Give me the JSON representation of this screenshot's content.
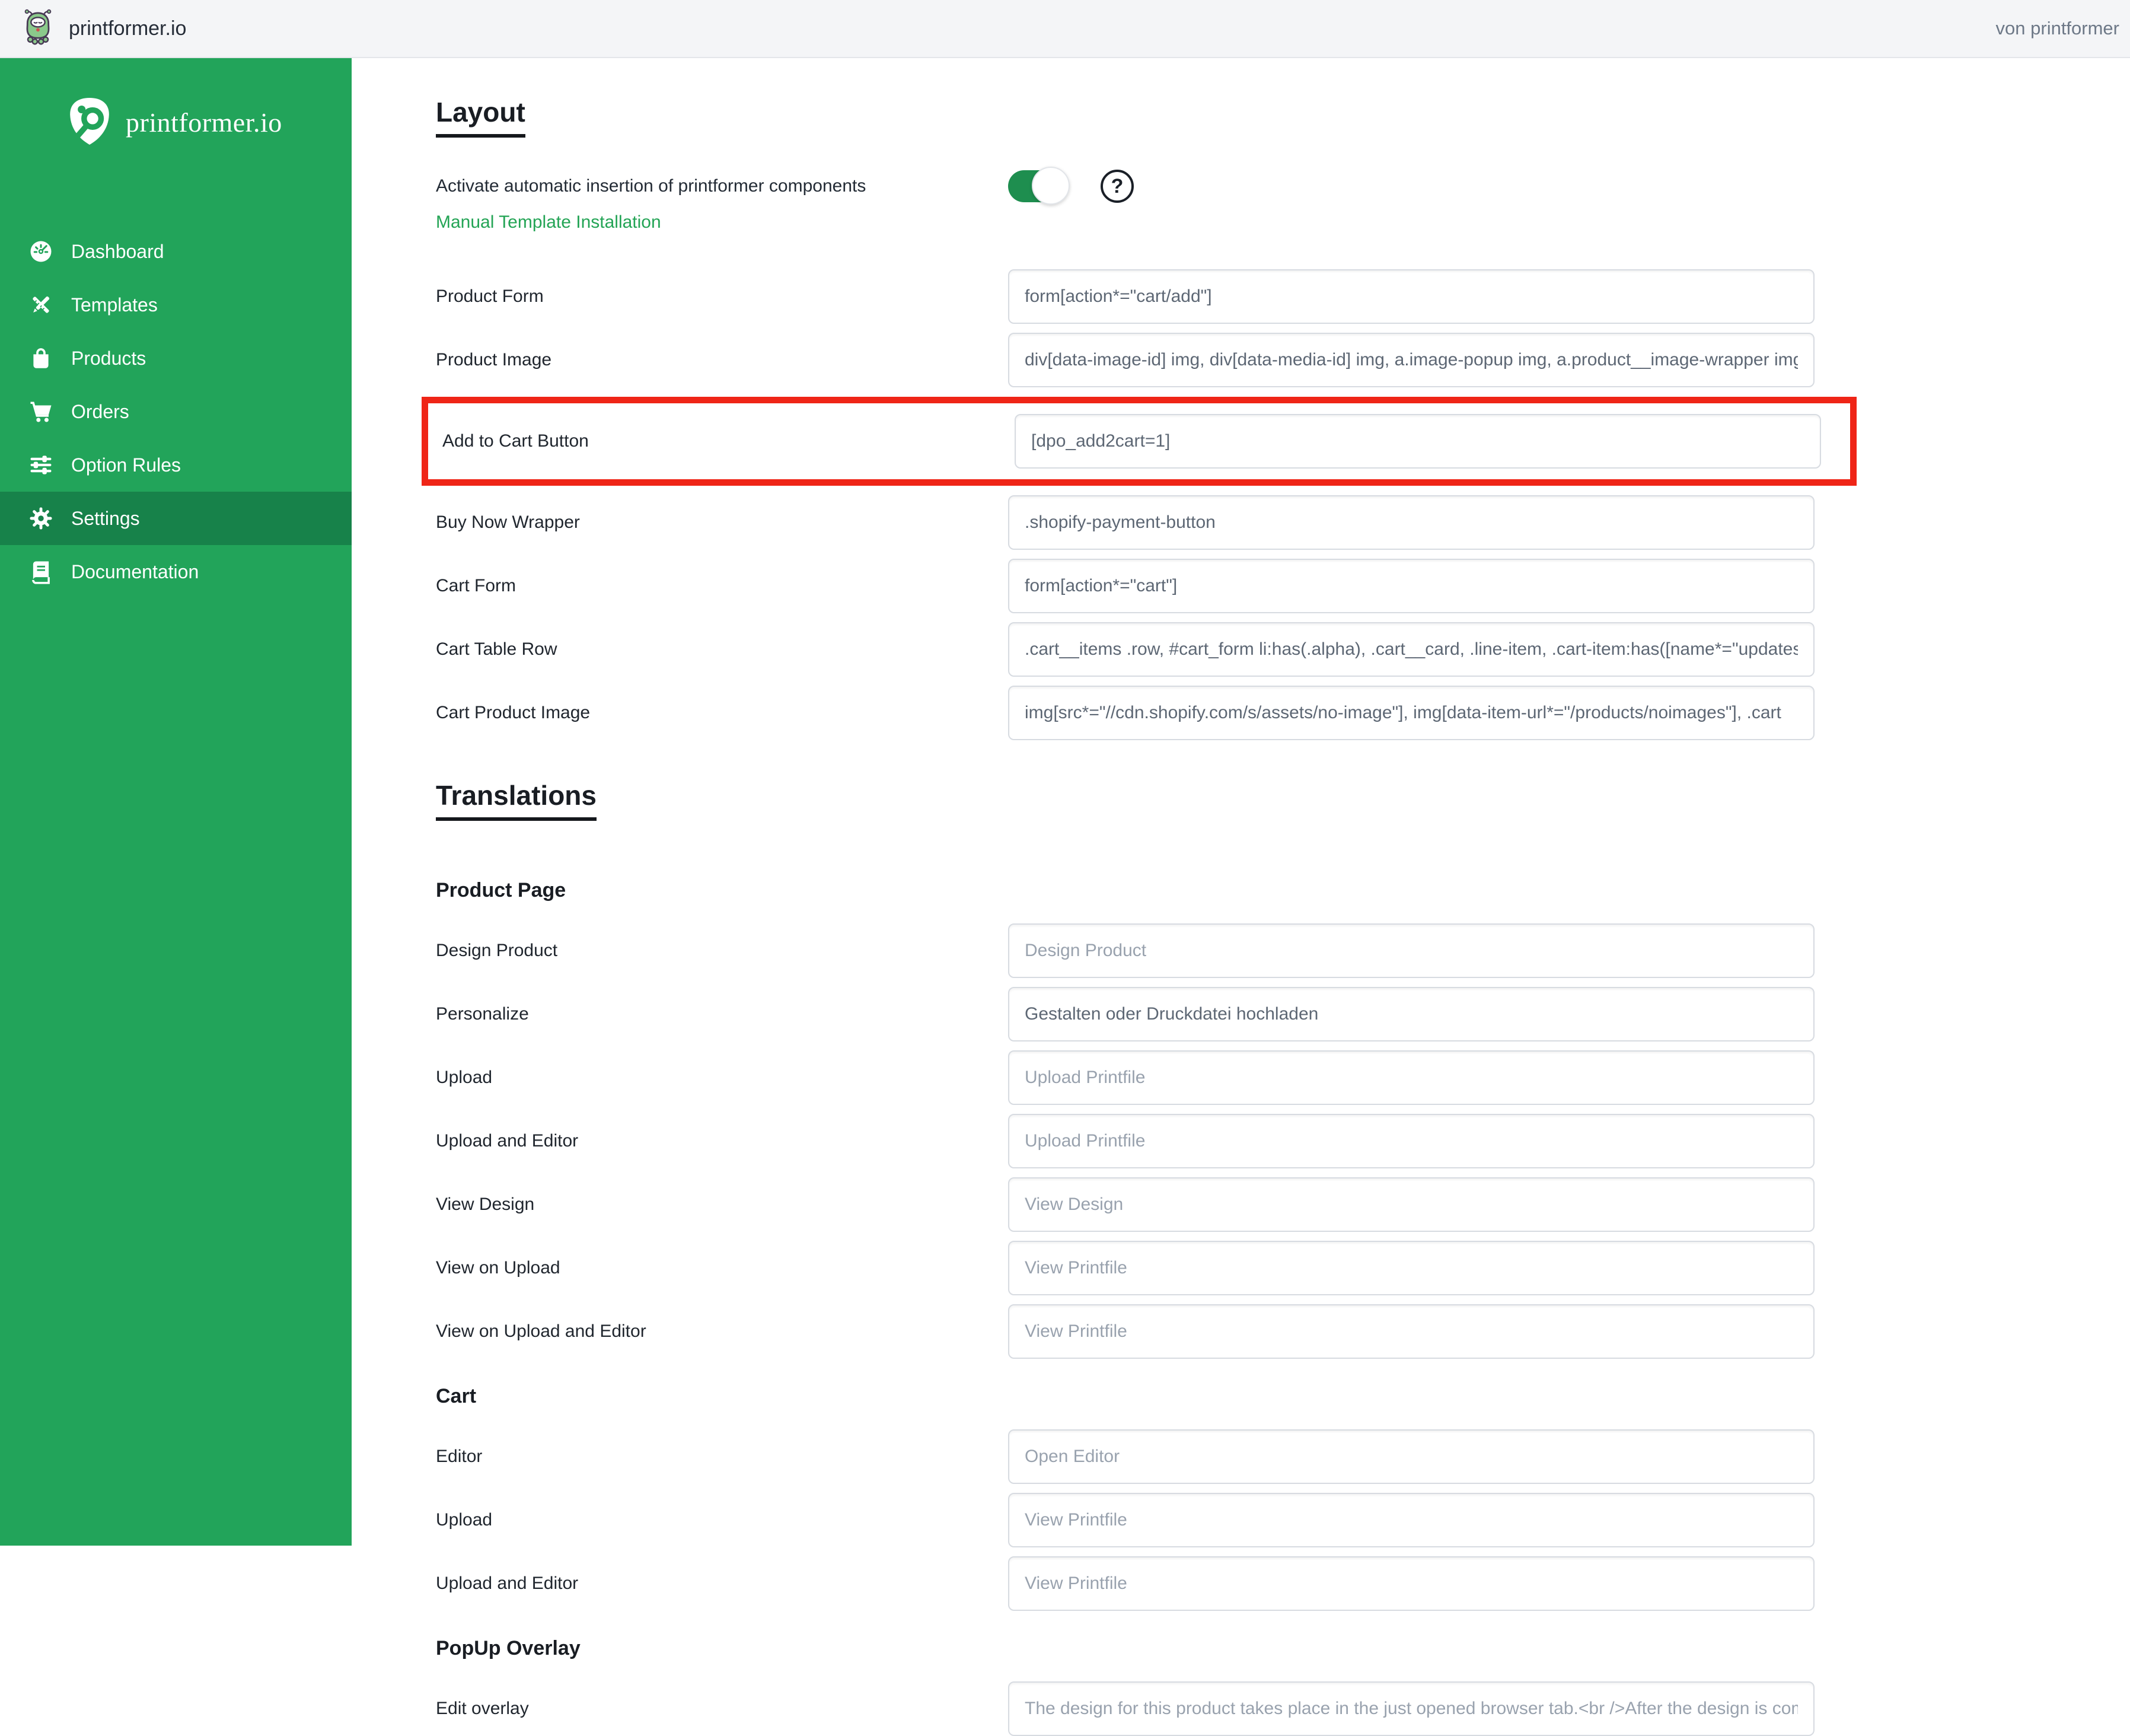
{
  "header": {
    "app_title": "printformer.io",
    "byline": "von printformer"
  },
  "sidebar": {
    "brand": "printformer.io",
    "items": [
      {
        "label": "Dashboard",
        "icon": "gauge-icon",
        "active": false
      },
      {
        "label": "Templates",
        "icon": "pencil-ruler-icon",
        "active": false
      },
      {
        "label": "Products",
        "icon": "shopping-bag-icon",
        "active": false
      },
      {
        "label": "Orders",
        "icon": "cart-icon",
        "active": false
      },
      {
        "label": "Option Rules",
        "icon": "sliders-icon",
        "active": false
      },
      {
        "label": "Settings",
        "icon": "gear-icon",
        "active": true
      },
      {
        "label": "Documentation",
        "icon": "book-icon",
        "active": false
      }
    ]
  },
  "main": {
    "layout_section": {
      "title": "Layout",
      "toggle_label": "Activate automatic insertion of printformer components",
      "toggle_state": "on",
      "help_glyph": "?",
      "manual_link": "Manual Template Installation",
      "rows": [
        {
          "label": "Product Form",
          "value": "form[action*=\"cart/add\"]"
        },
        {
          "label": "Product Image",
          "value": "div[data-image-id] img, div[data-media-id] img, a.image-popup img, a.product__image-wrapper img"
        },
        {
          "label": "Add to Cart Button",
          "value": "[dpo_add2cart=1]",
          "highlighted": true
        },
        {
          "label": "Buy Now Wrapper",
          "value": ".shopify-payment-button"
        },
        {
          "label": "Cart Form",
          "value": "form[action*=\"cart\"]"
        },
        {
          "label": "Cart Table Row",
          "value": ".cart__items .row, #cart_form li:has(.alpha), .cart__card, .line-item, .cart-item:has([name*=\"updates\"]"
        },
        {
          "label": "Cart Product Image",
          "value": "img[src*=\"//cdn.shopify.com/s/assets/no-image\"], img[data-item-url*=\"/products/noimages\"], .cart"
        }
      ]
    },
    "translations_section": {
      "title": "Translations",
      "groups": [
        {
          "heading": "Product Page",
          "rows": [
            {
              "label": "Design Product",
              "placeholder": "Design Product"
            },
            {
              "label": "Personalize",
              "value": "Gestalten oder Druckdatei hochladen"
            },
            {
              "label": "Upload",
              "placeholder": "Upload Printfile"
            },
            {
              "label": "Upload and Editor",
              "placeholder": "Upload Printfile"
            },
            {
              "label": "View Design",
              "placeholder": "View Design"
            },
            {
              "label": "View on Upload",
              "placeholder": "View Printfile"
            },
            {
              "label": "View on Upload and Editor",
              "placeholder": "View Printfile"
            }
          ]
        },
        {
          "heading": "Cart",
          "rows": [
            {
              "label": "Editor",
              "placeholder": "Open Editor"
            },
            {
              "label": "Upload",
              "placeholder": "View Printfile"
            },
            {
              "label": "Upload and Editor",
              "placeholder": "View Printfile"
            }
          ]
        },
        {
          "heading": "PopUp Overlay",
          "rows": [
            {
              "label": "Edit overlay",
              "placeholder": "The design for this product takes place in the just opened browser tab.<br />After the design is com"
            }
          ]
        }
      ]
    }
  },
  "colors": {
    "sidebar_green": "#22a45a",
    "active_item_green": "#17824a",
    "toggle_green": "#1e8e4f",
    "link_green": "#23a455",
    "highlight_red": "#ef2517",
    "header_bg": "#f4f5f7"
  }
}
